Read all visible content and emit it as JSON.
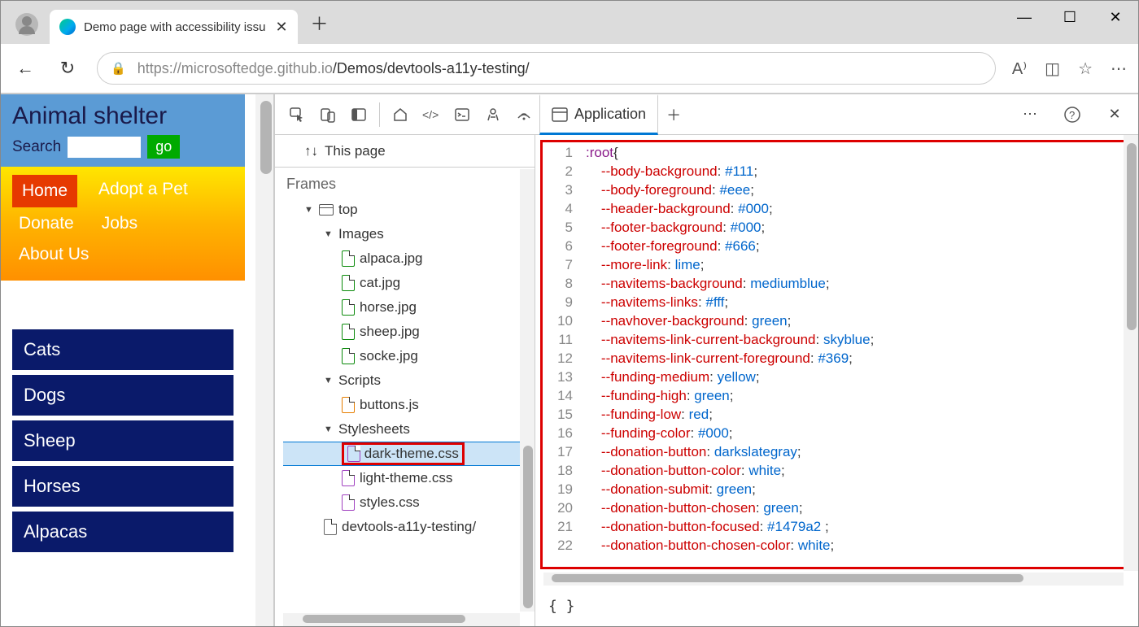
{
  "browser": {
    "tab_title": "Demo page with accessibility issu",
    "url_prefix": "https://",
    "url_host": "microsoftedge.github.io",
    "url_path": "/Demos/devtools-a11y-testing/"
  },
  "page": {
    "title": "Animal shelter",
    "search_label": "Search",
    "go_label": "go",
    "nav": [
      "Home",
      "Adopt a Pet",
      "Donate",
      "Jobs",
      "About Us"
    ],
    "categories": [
      "Cats",
      "Dogs",
      "Sheep",
      "Horses",
      "Alpacas"
    ]
  },
  "devtools": {
    "this_page": "This page",
    "frames_label": "Frames",
    "active_tab": "Application",
    "tree": {
      "top": "top",
      "groups": {
        "images": {
          "label": "Images",
          "files": [
            "alpaca.jpg",
            "cat.jpg",
            "horse.jpg",
            "sheep.jpg",
            "socke.jpg"
          ]
        },
        "scripts": {
          "label": "Scripts",
          "files": [
            "buttons.js"
          ]
        },
        "stylesheets": {
          "label": "Stylesheets",
          "files": [
            "dark-theme.css",
            "light-theme.css",
            "styles.css"
          ]
        }
      },
      "root_file": "devtools-a11y-testing/"
    },
    "code_footer": "{ }",
    "code_lines": [
      {
        "n": 1,
        "html": "<span class='t-sel'>:root</span><span class='t-punc'>{</span>"
      },
      {
        "n": 2,
        "html": "    <span class='t-prop'>--body-background</span>: <span class='t-val'>#111</span>;"
      },
      {
        "n": 3,
        "html": "    <span class='t-prop'>--body-foreground</span>: <span class='t-val'>#eee</span>;"
      },
      {
        "n": 4,
        "html": "    <span class='t-prop'>--header-background</span>: <span class='t-val'>#000</span>;"
      },
      {
        "n": 5,
        "html": "    <span class='t-prop'>--footer-background</span>: <span class='t-val'>#000</span>;"
      },
      {
        "n": 6,
        "html": "    <span class='t-prop'>--footer-foreground</span>: <span class='t-val'>#666</span>;"
      },
      {
        "n": 7,
        "html": "    <span class='t-prop'>--more-link</span>: <span class='t-val'>lime</span>;"
      },
      {
        "n": 8,
        "html": "    <span class='t-prop'>--navitems-background</span>: <span class='t-val'>mediumblue</span>;"
      },
      {
        "n": 9,
        "html": "    <span class='t-prop'>--navitems-links</span>: <span class='t-val'>#fff</span>;"
      },
      {
        "n": 10,
        "html": "    <span class='t-prop'>--navhover-background</span>: <span class='t-val'>green</span>;"
      },
      {
        "n": 11,
        "html": "    <span class='t-prop'>--navitems-link-current-background</span>: <span class='t-val'>skyblue</span>;"
      },
      {
        "n": 12,
        "html": "    <span class='t-prop'>--navitems-link-current-foreground</span>: <span class='t-val'>#369</span>;"
      },
      {
        "n": 13,
        "html": "    <span class='t-prop'>--funding-medium</span>: <span class='t-val'>yellow</span>;"
      },
      {
        "n": 14,
        "html": "    <span class='t-prop'>--funding-high</span>: <span class='t-val'>green</span>;"
      },
      {
        "n": 15,
        "html": "    <span class='t-prop'>--funding-low</span>: <span class='t-val'>red</span>;"
      },
      {
        "n": 16,
        "html": "    <span class='t-prop'>--funding-color</span>: <span class='t-val'>#000</span>;"
      },
      {
        "n": 17,
        "html": "    <span class='t-prop'>--donation-button</span>: <span class='t-val'>darkslategray</span>;"
      },
      {
        "n": 18,
        "html": "    <span class='t-prop'>--donation-button-color</span>: <span class='t-val'>white</span>;"
      },
      {
        "n": 19,
        "html": "    <span class='t-prop'>--donation-submit</span>: <span class='t-val'>green</span>;"
      },
      {
        "n": 20,
        "html": "    <span class='t-prop'>--donation-button-chosen</span>: <span class='t-val'>green</span>;"
      },
      {
        "n": 21,
        "html": "    <span class='t-prop'>--donation-button-focused</span>: <span class='t-val'>#1479a2</span> ;"
      },
      {
        "n": 22,
        "html": "    <span class='t-prop'>--donation-button-chosen-color</span>: <span class='t-val'>white</span>;"
      }
    ]
  }
}
